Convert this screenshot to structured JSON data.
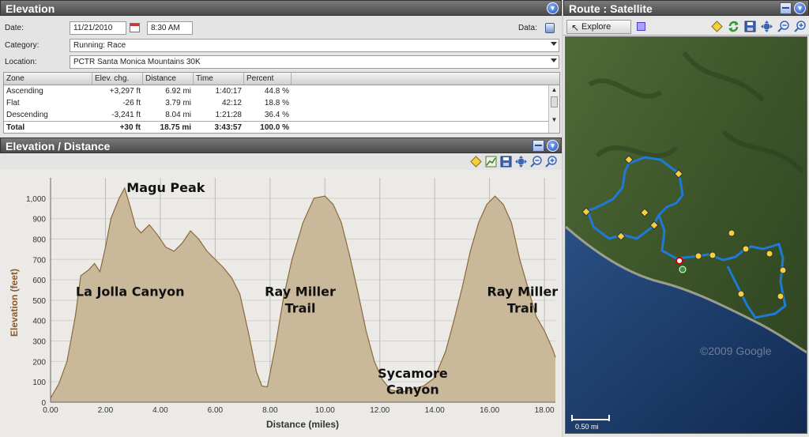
{
  "elevation_panel": {
    "title": "Elevation",
    "date_label": "Date:",
    "date_value": "11/21/2010",
    "time_value": "8:30 AM",
    "data_label": "Data:",
    "category_label": "Category:",
    "category_value": "Running: Race",
    "location_label": "Location:",
    "location_value": "PCTR Santa Monica Mountains 30K"
  },
  "zone_table": {
    "columns": [
      "Zone",
      "Elev. chg.",
      "Distance",
      "Time",
      "Percent"
    ],
    "rows": [
      {
        "zone": "Ascending",
        "elev": "+3,297 ft",
        "distance": "6.92 mi",
        "time": "1:40:17",
        "percent": "44.8 %"
      },
      {
        "zone": "Flat",
        "elev": "-26 ft",
        "distance": "3.79 mi",
        "time": "42:12",
        "percent": "18.8 %"
      },
      {
        "zone": "Descending",
        "elev": "-3,241 ft",
        "distance": "8.04 mi",
        "time": "1:21:28",
        "percent": "36.4 %"
      }
    ],
    "total": {
      "zone": "Total",
      "elev": "+30 ft",
      "distance": "18.75 mi",
      "time": "3:43:57",
      "percent": "100.0 %"
    }
  },
  "chart_panel": {
    "title": "Elevation / Distance"
  },
  "chart_data": {
    "type": "area",
    "xlabel": "Distance (miles)",
    "ylabel": "Elevation (feet)",
    "xlim": [
      0,
      18.4
    ],
    "ylim": [
      0,
      1100
    ],
    "xticks": [
      0,
      2,
      4,
      6,
      8,
      10,
      12,
      14,
      16,
      18
    ],
    "xtick_labels": [
      "0.00",
      "2.00",
      "4.00",
      "6.00",
      "8.00",
      "10.00",
      "12.00",
      "14.00",
      "16.00",
      "18.00"
    ],
    "yticks": [
      0,
      100,
      200,
      300,
      400,
      500,
      600,
      700,
      800,
      900,
      1000
    ],
    "ytick_labels": [
      "0",
      "100",
      "200",
      "300",
      "400",
      "500",
      "600",
      "700",
      "800",
      "900",
      "1,000"
    ],
    "grid": true,
    "fill_color": "#c9b89a",
    "line_color": "#8a6a3a",
    "x": [
      0,
      0.3,
      0.6,
      0.9,
      1.1,
      1.4,
      1.6,
      1.8,
      2.0,
      2.2,
      2.5,
      2.7,
      2.9,
      3.1,
      3.3,
      3.6,
      3.9,
      4.2,
      4.5,
      4.8,
      5.1,
      5.4,
      5.7,
      6.0,
      6.3,
      6.6,
      6.9,
      7.2,
      7.5,
      7.7,
      7.9,
      8.2,
      8.5,
      8.8,
      9.2,
      9.6,
      10.0,
      10.3,
      10.6,
      10.9,
      11.2,
      11.5,
      11.8,
      12.1,
      12.4,
      12.8,
      13.2,
      13.6,
      14.0,
      14.4,
      14.7,
      15.0,
      15.3,
      15.6,
      15.9,
      16.2,
      16.5,
      16.8,
      17.1,
      17.4,
      17.7,
      18.0,
      18.3,
      18.4
    ],
    "y": [
      20,
      90,
      200,
      420,
      620,
      650,
      680,
      640,
      760,
      900,
      1000,
      1050,
      960,
      860,
      830,
      870,
      820,
      760,
      740,
      780,
      840,
      800,
      740,
      700,
      660,
      610,
      530,
      350,
      150,
      80,
      75,
      280,
      520,
      700,
      880,
      1000,
      1010,
      970,
      880,
      720,
      540,
      350,
      200,
      110,
      60,
      50,
      65,
      80,
      120,
      250,
      400,
      560,
      740,
      880,
      970,
      1010,
      970,
      880,
      700,
      560,
      420,
      350,
      260,
      220
    ],
    "annotations": [
      {
        "text": "Magu Peak",
        "x": 4.2,
        "y": 1030
      },
      {
        "text": "La Jolla Canyon",
        "x": 2.9,
        "y": 520
      },
      {
        "text": "Ray Miller",
        "x": 9.1,
        "y": 520
      },
      {
        "text": "Trail",
        "x": 9.1,
        "y": 440
      },
      {
        "text": "Sycamore",
        "x": 13.2,
        "y": 120
      },
      {
        "text": "Canyon",
        "x": 13.2,
        "y": 40
      },
      {
        "text": "Ray Miller",
        "x": 17.2,
        "y": 520
      },
      {
        "text": "Trail",
        "x": 17.2,
        "y": 440
      }
    ]
  },
  "route_panel": {
    "title": "Route : Satellite",
    "explore_label": "Explore",
    "watermark": "©2009 Google",
    "scale_label": "0.50 mi"
  },
  "colors": {
    "titlebar": "#555555",
    "route": "#1e7ad6",
    "water": "#1d3a66",
    "land": "#3f5a2a"
  }
}
